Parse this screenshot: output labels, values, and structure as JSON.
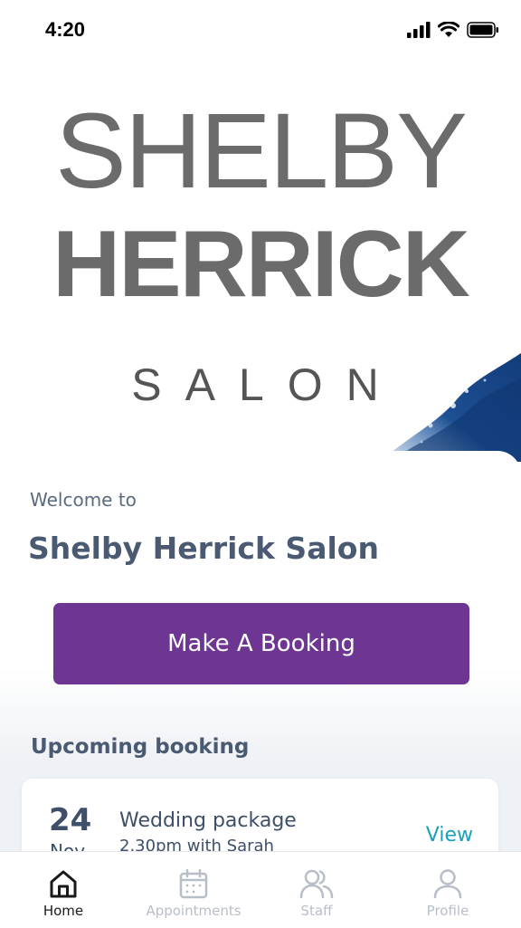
{
  "status_bar": {
    "time": "4:20"
  },
  "logo": {
    "line1": "SHELBY",
    "line2": "HERRICK",
    "line3": "SALON"
  },
  "welcome": {
    "greeting": "Welcome to",
    "salon_name": "Shelby Herrick Salon"
  },
  "booking_button": {
    "label": "Make A Booking"
  },
  "upcoming": {
    "heading": "Upcoming booking",
    "booking": {
      "day": "24",
      "month": "Nov",
      "title": "Wedding package",
      "subtitle": "2.30pm with Sarah",
      "action": "View"
    }
  },
  "tabs": [
    {
      "label": "Home",
      "icon": "home-icon",
      "active": true
    },
    {
      "label": "Appointments",
      "icon": "calendar-icon",
      "active": false
    },
    {
      "label": "Staff",
      "icon": "people-icon",
      "active": false
    },
    {
      "label": "Profile",
      "icon": "person-icon",
      "active": false
    }
  ],
  "colors": {
    "primary": "#6e3693",
    "heading_text": "#4a5a72",
    "link": "#1aa0bf",
    "tab_inactive": "#b8bec8",
    "logo_gray": "#6b6b6b"
  }
}
